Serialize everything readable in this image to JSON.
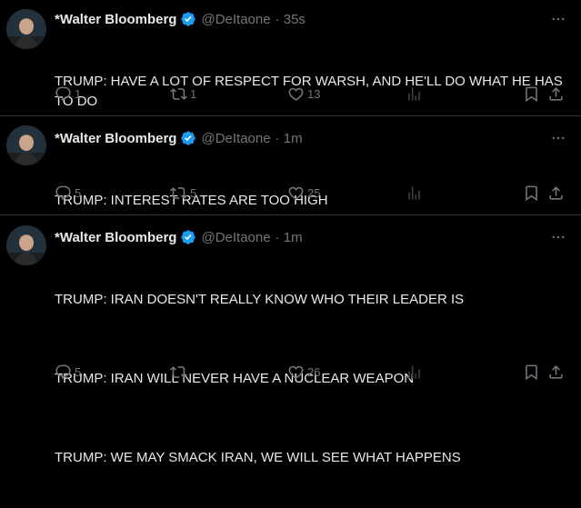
{
  "tweets": [
    {
      "name": "*Walter Bloomberg",
      "handle": "@DeItaone",
      "time": "· 35s",
      "lines": [
        "TRUMP: HAVE A LOT OF RESPECT FOR WARSH, AND HE'LL DO WHAT HE HAS TO DO"
      ],
      "replies": "1",
      "reposts": "1",
      "likes": "13",
      "views": ""
    },
    {
      "name": "*Walter Bloomberg",
      "handle": "@DeItaone",
      "time": "· 1m",
      "lines": [
        "TRUMP: INTEREST RATES ARE TOO HIGH"
      ],
      "replies": "5",
      "reposts": "5",
      "likes": "25",
      "views": ""
    },
    {
      "name": "*Walter Bloomberg",
      "handle": "@DeItaone",
      "time": "· 1m",
      "lines": [
        "TRUMP: IRAN DOESN'T REALLY KNOW WHO THEIR LEADER IS",
        "TRUMP: IRAN WILL NEVER HAVE A NUCLEAR WEAPON",
        "TRUMP: WE MAY SMACK IRAN, WE WILL SEE WHAT HAPPENS"
      ],
      "replies": "5",
      "reposts": "",
      "likes": "26",
      "views": ""
    }
  ],
  "icons": {
    "reply": "reply-icon",
    "repost": "repost-icon",
    "like": "like-icon",
    "views": "views-icon",
    "bookmark": "bookmark-icon",
    "share": "share-icon",
    "more": "more-icon",
    "verified": "verified-badge-icon"
  },
  "colors": {
    "background": "#000000",
    "text": "#e7e9ea",
    "muted": "#71767b",
    "verified": "#1d9bf0",
    "divider": "#2f3336"
  }
}
